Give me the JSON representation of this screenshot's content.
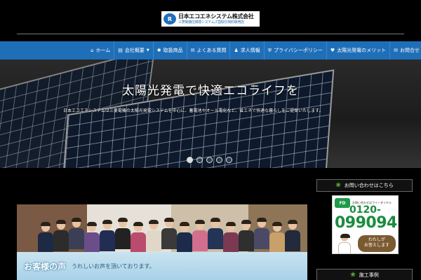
{
  "header": {
    "logo_mark": "R",
    "logo_main": "日本エコエネシステム株式会社",
    "logo_sub": "三菱電機住環境システムズ直取引契約販売店"
  },
  "nav": {
    "items": [
      {
        "label": "ホーム",
        "icon": "home-icon",
        "has_caret": false
      },
      {
        "label": "会社概要",
        "icon": "building-icon",
        "has_caret": true
      },
      {
        "label": "取扱商品",
        "icon": "gear-icon",
        "has_caret": false
      },
      {
        "label": "よくある質問",
        "icon": "chat-icon",
        "has_caret": false
      },
      {
        "label": "求人情報",
        "icon": "person-icon",
        "has_caret": false
      },
      {
        "label": "プライバシーポリシー",
        "icon": "shield-icon",
        "has_caret": false
      },
      {
        "label": "太陽光発電のメリット",
        "icon": "heart-icon",
        "has_caret": false
      },
      {
        "label": "お問合せ",
        "icon": "mail-icon",
        "has_caret": true
      }
    ]
  },
  "hero": {
    "title": "太陽光発電で快適エコライフを",
    "subtitle": "日本エコエネシステムは三菱電機の太陽光発電システムを中心に、蓄電池やオール電化など、省エネで快適な暮らしをご提案いたします。",
    "slide_count": 5,
    "active_slide": 1
  },
  "banner": {
    "title": "お客様の声",
    "subtitle": "うれしいお声を頂いております。"
  },
  "sidebar": {
    "widget1_title": "お問い合わせはこちら",
    "ad_caption": "お問い合わせはフリーダイヤル",
    "fd_label": "FD",
    "phone_prefix": "0120-",
    "phone_number": "099094",
    "ad_bubble": "わたしが\nお答えします",
    "widget2_title": "施工事例"
  },
  "colors": {
    "nav_bg": "#1f6fb8",
    "accent_green": "#1a8c3e"
  }
}
